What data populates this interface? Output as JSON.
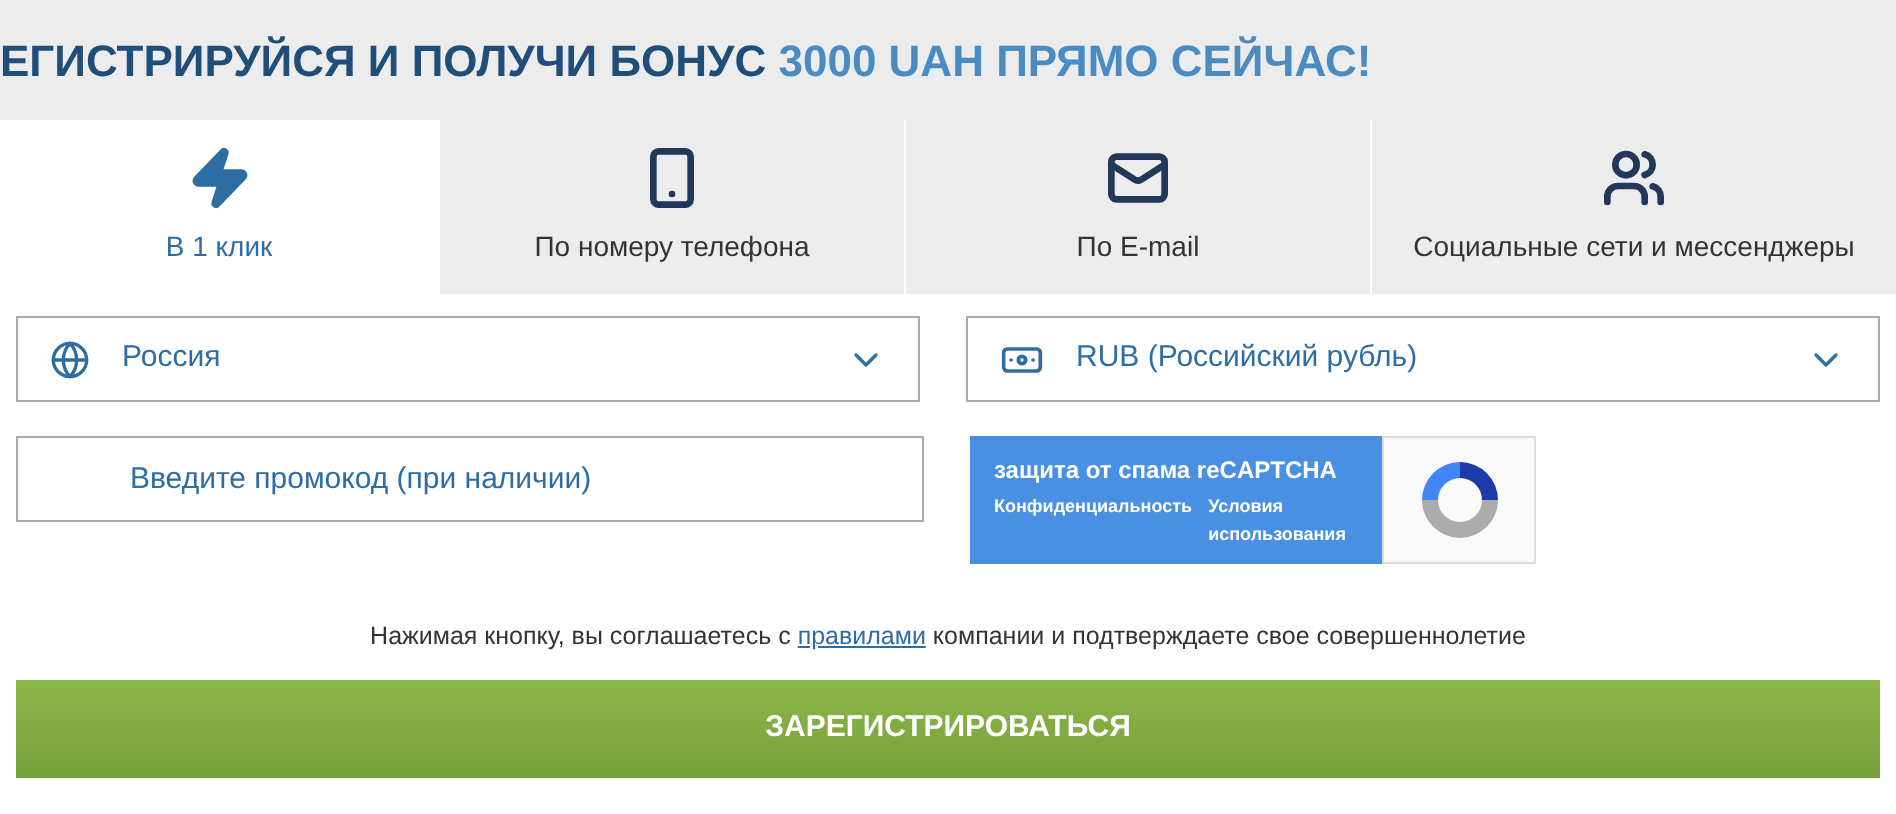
{
  "header": {
    "title": "ЕГИСТРИРУЙСЯ И ПОЛУЧИ БОНУС",
    "highlight": "3000 UAH ПРЯМО СЕЙЧАС!"
  },
  "tabs": [
    {
      "label": "В 1 клик",
      "kind": "bolt",
      "selected": true
    },
    {
      "label": "По номеру телефона",
      "kind": "phone",
      "selected": false
    },
    {
      "label": "По E-mail",
      "kind": "mail",
      "selected": false
    },
    {
      "label": "Социальные сети и мессенджеры",
      "kind": "users",
      "selected": false
    }
  ],
  "country": {
    "value": "Россия"
  },
  "currency": {
    "value": "RUB (Российский рубль)"
  },
  "promo": {
    "placeholder": "Введите промокод (при наличии)"
  },
  "captcha": {
    "title": "защита от спама reCAPTCHA",
    "privacy": "Конфиденциальность",
    "terms": "Условия использования"
  },
  "agreement": {
    "before": "Нажимая кнопку, вы соглашаетесь с",
    "link": "правилами",
    "after": "компании и подтверждаете свое совершеннолетие"
  },
  "submit": "ЗАРЕГИСТРИРОВАТЬСЯ"
}
